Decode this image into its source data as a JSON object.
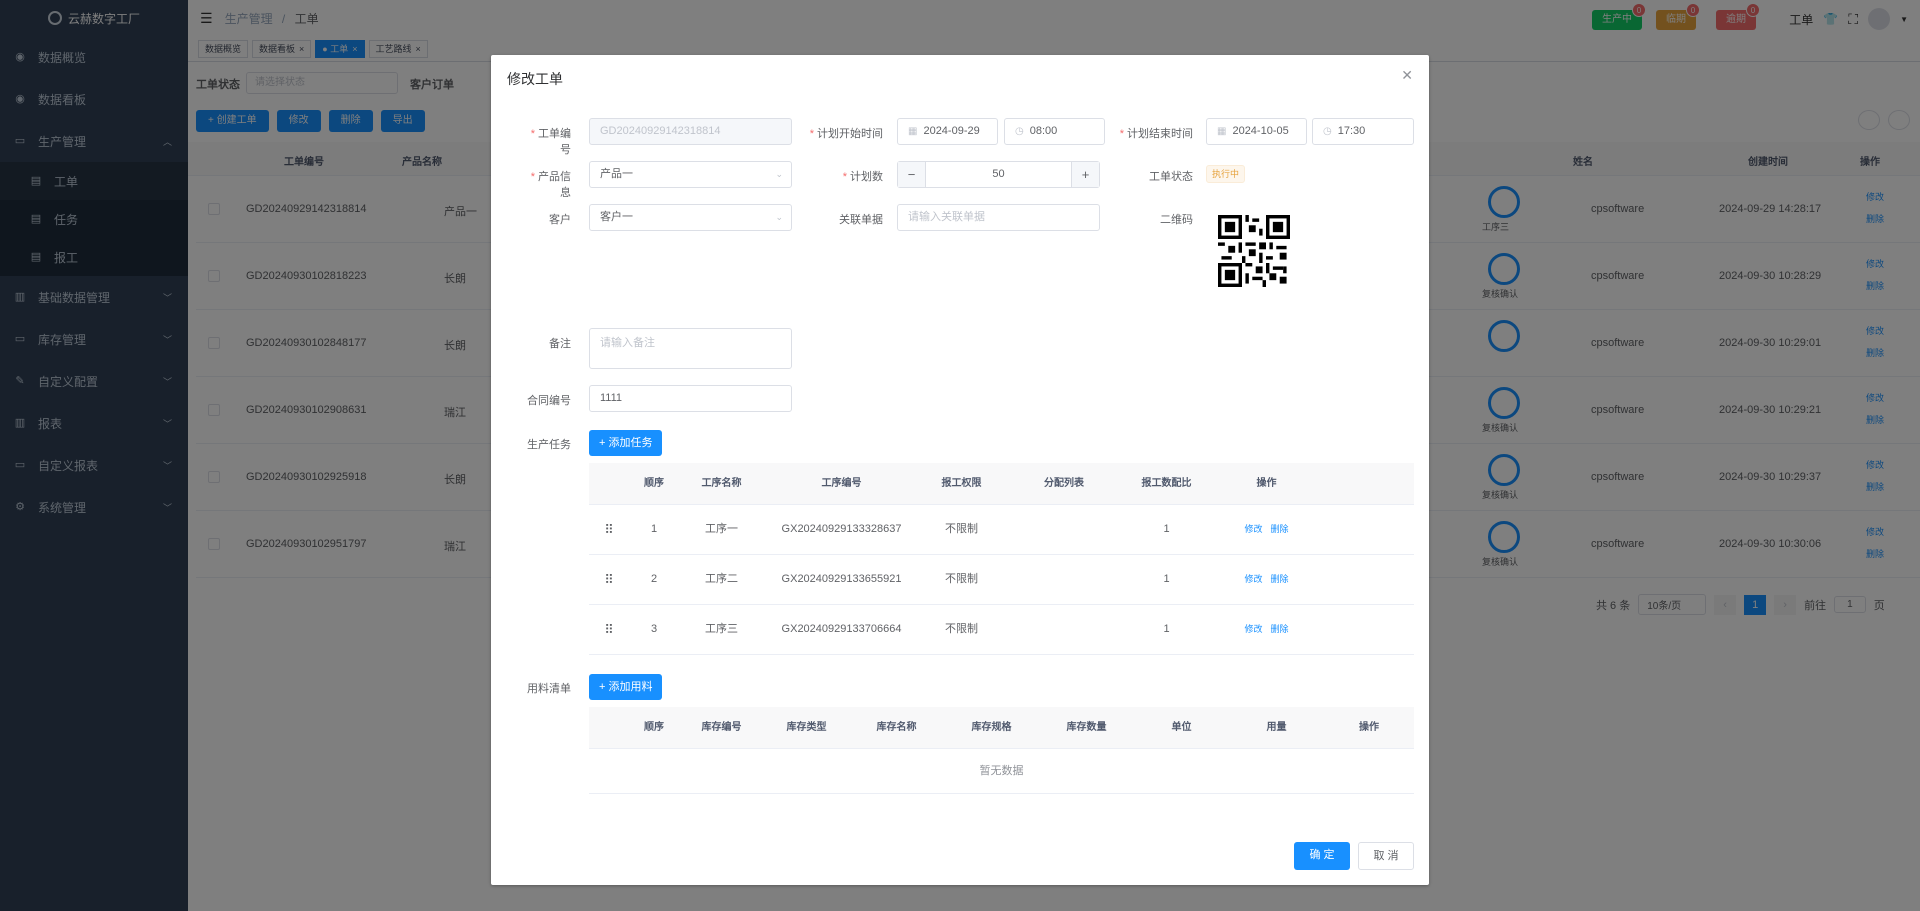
{
  "app": {
    "logo_text": "云赫数字工厂"
  },
  "sidebar": {
    "items": [
      {
        "label": "数据概览",
        "icon": "dashboard-icon"
      },
      {
        "label": "数据看板",
        "icon": "dashboard-icon"
      },
      {
        "label": "生产管理",
        "icon": "monitor-icon",
        "expanded": true
      },
      {
        "label": "工单",
        "icon": "document-icon",
        "sub": true,
        "active": true
      },
      {
        "label": "任务",
        "icon": "document-icon",
        "sub": true
      },
      {
        "label": "报工",
        "icon": "document-icon",
        "sub": true
      },
      {
        "label": "基础数据管理",
        "icon": "book-icon"
      },
      {
        "label": "库存管理",
        "icon": "monitor-icon"
      },
      {
        "label": "自定义配置",
        "icon": "edit-icon"
      },
      {
        "label": "报表",
        "icon": "book-icon"
      },
      {
        "label": "自定义报表",
        "icon": "monitor-icon"
      },
      {
        "label": "系统管理",
        "icon": "gear-icon"
      }
    ]
  },
  "header": {
    "breadcrumb": [
      "生产管理",
      "工单"
    ],
    "badges": [
      {
        "label": "生产中",
        "count": "0",
        "color": "#13ce66"
      },
      {
        "label": "临期",
        "count": "0",
        "color": "#e6a23c"
      },
      {
        "label": "逾期",
        "count": "0",
        "color": "#f56c6c"
      }
    ],
    "user_label": "工单"
  },
  "tags": [
    {
      "label": "数据概览",
      "active": false
    },
    {
      "label": "数据看板",
      "active": false,
      "closable": true
    },
    {
      "label": "● 工单",
      "active": true,
      "closable": true
    },
    {
      "label": "工艺路线",
      "active": false,
      "closable": true
    }
  ],
  "background": {
    "filter_label": "工单状态",
    "filter_placeholder": "请选择状态",
    "filter2_label": "客户订单",
    "toolbar": [
      "+ 创建工单",
      "修改",
      "删除",
      "导出"
    ],
    "columns": [
      "工单编号",
      "产品名称",
      "姓名",
      "创建时间",
      "操作"
    ],
    "rows": [
      {
        "code": "GD20240929142318814",
        "product": "产品一",
        "node": "工序三",
        "name": "cpsoftware",
        "time": "2024-09-29 14:28:17"
      },
      {
        "code": "GD20240930102818223",
        "product": "长朗",
        "node": "复核确认",
        "name": "cpsoftware",
        "time": "2024-09-30 10:28:29"
      },
      {
        "code": "GD20240930102848177",
        "product": "长朗",
        "node": "",
        "name": "cpsoftware",
        "time": "2024-09-30 10:29:01"
      },
      {
        "code": "GD20240930102908631",
        "product": "瑞江",
        "node": "复核确认",
        "name": "cpsoftware",
        "time": "2024-09-30 10:29:21"
      },
      {
        "code": "GD20240930102925918",
        "product": "长朗",
        "node": "复核确认",
        "name": "cpsoftware",
        "time": "2024-09-30 10:29:37"
      },
      {
        "code": "GD20240930102951797",
        "product": "瑞江",
        "node": "复核确认",
        "name": "cpsoftware",
        "time": "2024-09-30 10:30:06"
      }
    ],
    "edit_link": "修改",
    "delete_link": "删除",
    "pagination": {
      "total": "共 6 条",
      "page_size": "10条/页",
      "current": "1",
      "goto_label": "前往",
      "goto_value": "1",
      "page_suffix": "页"
    }
  },
  "dialog": {
    "title": "修改工单",
    "fields": {
      "order_no_label": "工单编号",
      "order_no_value": "GD20240929142318814",
      "plan_start_label": "计划开始时间",
      "plan_start_date": "2024-09-29",
      "plan_start_time": "08:00",
      "plan_end_label": "计划结束时间",
      "plan_end_date": "2024-10-05",
      "plan_end_time": "17:30",
      "product_label": "产品信息",
      "product_value": "产品一",
      "plan_qty_label": "计划数",
      "plan_qty_value": "50",
      "status_label": "工单状态",
      "status_value": "执行中",
      "customer_label": "客户",
      "customer_value": "客户一",
      "related_label": "关联单据",
      "related_placeholder": "请输入关联单据",
      "qrcode_label": "二维码",
      "remark_label": "备注",
      "remark_placeholder": "请输入备注",
      "contract_label": "合同编号",
      "contract_value": "1111",
      "tasks_label": "生产任务",
      "add_task_button": "+ 添加任务",
      "materials_label": "用料清单",
      "add_material_button": "+ 添加用料"
    },
    "task_table": {
      "columns": [
        "顺序",
        "工序名称",
        "工序编号",
        "报工权限",
        "分配列表",
        "报工数配比",
        "操作"
      ],
      "rows": [
        {
          "order": "1",
          "name": "工序一",
          "code": "GX20240929133328637",
          "perm": "不限制",
          "assign": "",
          "ratio": "1"
        },
        {
          "order": "2",
          "name": "工序二",
          "code": "GX20240929133655921",
          "perm": "不限制",
          "assign": "",
          "ratio": "1"
        },
        {
          "order": "3",
          "name": "工序三",
          "code": "GX20240929133706664",
          "perm": "不限制",
          "assign": "",
          "ratio": "1"
        }
      ],
      "edit_link": "修改",
      "delete_link": "删除"
    },
    "material_table": {
      "columns": [
        "顺序",
        "库存编号",
        "库存类型",
        "库存名称",
        "库存规格",
        "库存数量",
        "单位",
        "用量",
        "操作"
      ],
      "empty_text": "暂无数据"
    },
    "confirm_button": "确 定",
    "cancel_button": "取 消"
  }
}
